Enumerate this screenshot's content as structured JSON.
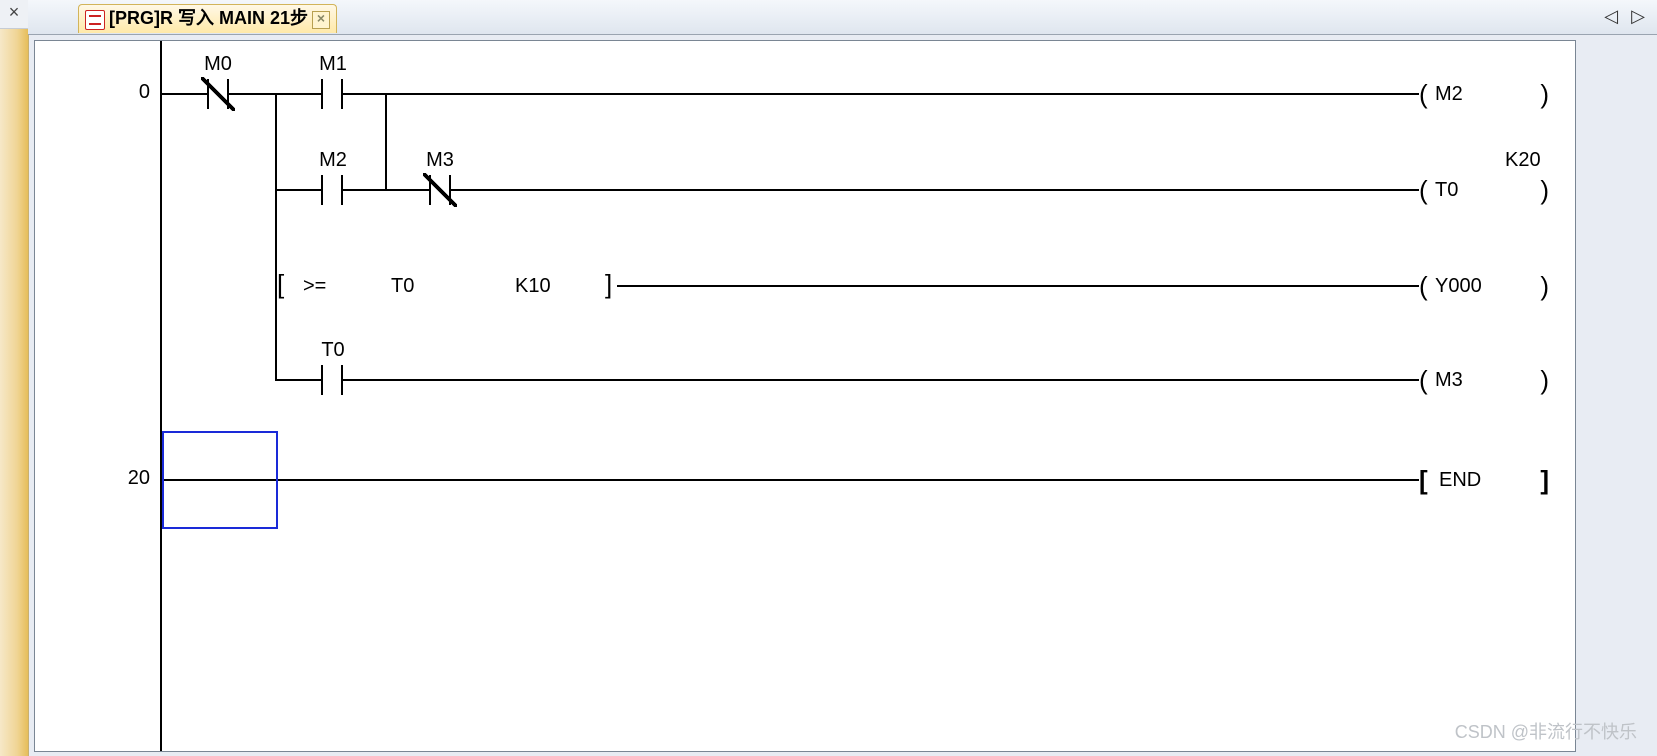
{
  "sidebar": {
    "close_x": "×"
  },
  "tab": {
    "title": "[PRG]R 写入 MAIN 21步",
    "close": "×",
    "nav_left": "◁",
    "nav_right": "▷"
  },
  "ladder": {
    "step0": "0",
    "step20": "20",
    "network0": {
      "rung1": {
        "contacts": [
          {
            "type": "NC",
            "device": "M0"
          },
          {
            "type": "NO",
            "device": "M1"
          }
        ],
        "coil": "M2"
      },
      "rung2": {
        "contacts": [
          {
            "type": "NO",
            "device": "M2"
          },
          {
            "type": "NC",
            "device": "M3"
          }
        ],
        "coil": "T0",
        "preset_label": "K20"
      },
      "rung3": {
        "compare": {
          "op": ">=",
          "a": "T0",
          "b": "K10"
        },
        "coil": "Y000"
      },
      "rung4": {
        "contacts": [
          {
            "type": "NO",
            "device": "T0"
          }
        ],
        "coil": "M3"
      }
    },
    "end_label": "END"
  },
  "watermark": "CSDN @非流行不快乐"
}
